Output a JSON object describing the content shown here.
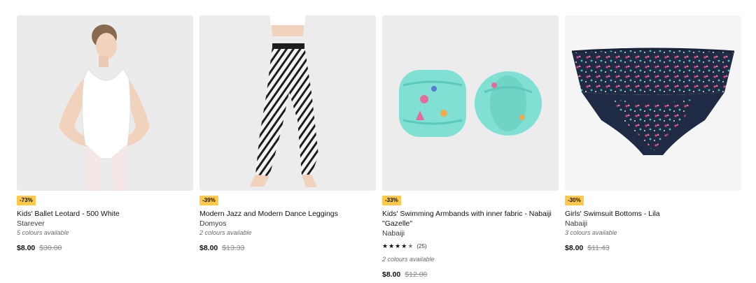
{
  "products": [
    {
      "discount": "-73%",
      "title": "Kids' Ballet Leotard - 500 White",
      "brand": "Starever",
      "colors": "5 colours available",
      "price": "$8.00",
      "old_price": "$30.00",
      "image_icon": "ballet-leotard-photo"
    },
    {
      "discount": "-39%",
      "title": "Modern Jazz and Modern Dance Leggings",
      "brand": "Domyos",
      "colors": "2 colours available",
      "price": "$8.00",
      "old_price": "$13.33",
      "image_icon": "dance-leggings-photo"
    },
    {
      "discount": "-33%",
      "title": "Kids' Swimming Armbands with inner fabric - Nabaiji \"Gazelle\"",
      "brand": "Nabaiji",
      "rating": 4.5,
      "reviews": "(25)",
      "colors": "2 colours available",
      "price": "$8.00",
      "old_price": "$12.00",
      "image_icon": "swimming-armbands-photo"
    },
    {
      "discount": "-30%",
      "title": "Girls' Swimsuit Bottoms - Lila",
      "brand": "Nabaiji",
      "colors": "3 colours available",
      "price": "$8.00",
      "old_price": "$11.43",
      "image_icon": "swimsuit-bottoms-photo"
    }
  ],
  "colors": {
    "badge": "#ffc94a",
    "image_bg": "#ececec",
    "text": "#101010",
    "muted": "#6b6b6b"
  }
}
